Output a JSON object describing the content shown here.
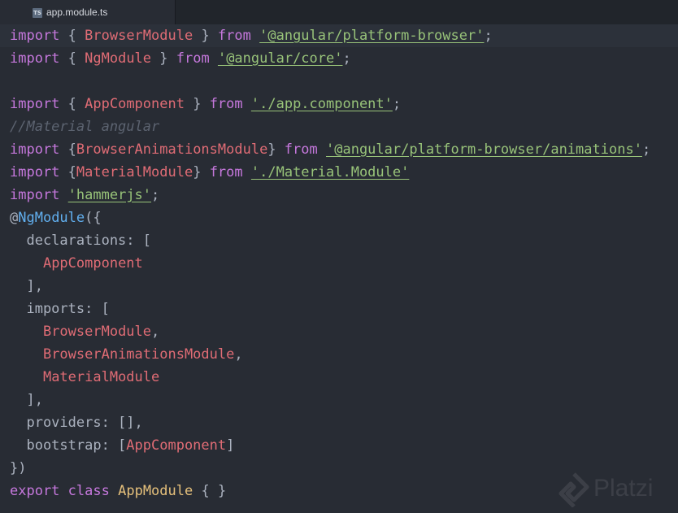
{
  "tab": {
    "icon_label": "TS",
    "filename": "app.module.ts"
  },
  "code": {
    "l1": [
      "import",
      " { ",
      "BrowserModule",
      " } ",
      "from",
      " ",
      "'@angular/platform-browser'",
      ";"
    ],
    "l2": [
      "import",
      " { ",
      "NgModule",
      " } ",
      "from",
      " ",
      "'@angular/core'",
      ";"
    ],
    "l4": [
      "import",
      " { ",
      "AppComponent",
      " } ",
      "from",
      " ",
      "'./app.component'",
      ";"
    ],
    "l5": [
      "//Material angular"
    ],
    "l6": [
      "import",
      " {",
      "BrowserAnimationsModule",
      "} ",
      "from",
      " ",
      "'@angular/platform-browser/animations'",
      ";"
    ],
    "l7": [
      "import",
      " {",
      "MaterialModule",
      "} ",
      "from",
      " ",
      "'./Material.Module'"
    ],
    "l8": [
      "import",
      " ",
      "'hammerjs'",
      ";"
    ],
    "l9": [
      "@",
      "NgModule",
      "({"
    ],
    "l10": [
      "  declarations: ["
    ],
    "l11": [
      "    ",
      "AppComponent"
    ],
    "l12": [
      "  ],"
    ],
    "l13": [
      "  imports: ["
    ],
    "l14": [
      "    ",
      "BrowserModule",
      ","
    ],
    "l15": [
      "    ",
      "BrowserAnimationsModule",
      ","
    ],
    "l16": [
      "    ",
      "MaterialModule"
    ],
    "l17": [
      "  ],"
    ],
    "l18": [
      "  providers: [],"
    ],
    "l19": [
      "  bootstrap: [",
      "AppComponent",
      "]"
    ],
    "l20": [
      "})"
    ],
    "l21": [
      "export",
      " ",
      "class",
      " ",
      "AppModule",
      " { }"
    ]
  },
  "watermark": {
    "text": "Platzi",
    "color": "#ffffff"
  },
  "colors": {
    "background": "#282c34",
    "keyword": "#c678dd",
    "class_name": "#e06c75",
    "type_name": "#e5c07b",
    "decorator": "#61afef",
    "string": "#98c379",
    "comment": "#5c6370"
  }
}
